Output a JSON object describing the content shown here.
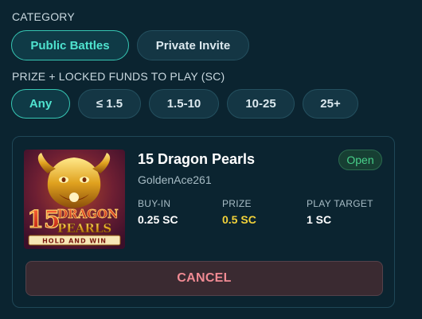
{
  "category": {
    "label": "CATEGORY",
    "options": [
      "Public Battles",
      "Private Invite"
    ],
    "selected": "Public Battles"
  },
  "prize_filter": {
    "label": "PRIZE + LOCKED FUNDS TO PLAY (SC)",
    "options": [
      "Any",
      "≤ 1.5",
      "1.5-10",
      "10-25",
      "25+"
    ],
    "selected": "Any"
  },
  "battle": {
    "game_title": "15 Dragon Pearls",
    "host": "GoldenAce261",
    "status": "Open",
    "thumbnail": {
      "title_text": "15 DRAGON PEARLS",
      "subtitle_text": "HOLD AND WIN"
    },
    "stats": [
      {
        "label": "BUY-IN",
        "value": "0.25 SC"
      },
      {
        "label": "PRIZE",
        "value": "0.5 SC"
      },
      {
        "label": "PLAY TARGET",
        "value": "1 SC"
      }
    ],
    "cancel_label": "CANCEL"
  },
  "colors": {
    "background": "#0b2430",
    "accent": "#4fe3cf",
    "prize": "#f2d23a",
    "open_badge": "#48d08a",
    "cancel_text": "#f08a93"
  }
}
